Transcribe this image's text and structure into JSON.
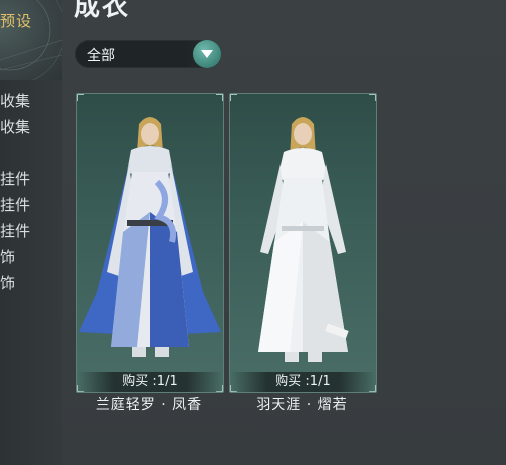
{
  "sidebar": {
    "preset_label": "预设",
    "items": [
      {
        "label": "收集"
      },
      {
        "label": "收集"
      },
      {
        "label": "挂件"
      },
      {
        "label": "挂件"
      },
      {
        "label": "挂件"
      },
      {
        "label": "饰"
      },
      {
        "label": "饰"
      }
    ]
  },
  "header": {
    "title": "成衣"
  },
  "filter": {
    "selected": "全部"
  },
  "cards": [
    {
      "buy_text": "购买 :1/1",
      "name": "兰庭轻罗 · 凤香",
      "robe_color": "#3a5fb8"
    },
    {
      "buy_text": "购买 :1/1",
      "name": "羽天涯 · 熠若",
      "robe_color": "#e8ecef"
    }
  ],
  "colors": {
    "accent_gold": "#e2c06b",
    "card_border": "#5d7f77",
    "dropdown_button": "#3d8579"
  }
}
